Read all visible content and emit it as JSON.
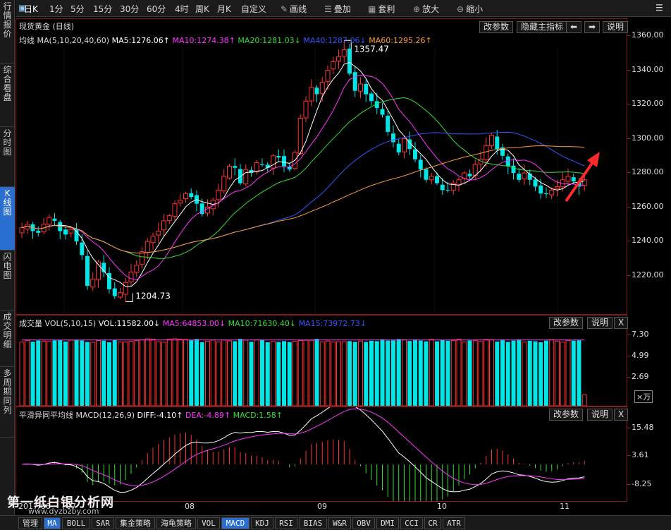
{
  "left_nav": [
    "行情报价",
    "综合看盘",
    "分时图",
    "K线图",
    "闪电图",
    "成交明细",
    "多周期同列"
  ],
  "left_nav_active": 3,
  "toolbar": {
    "periods": [
      "日K",
      "1分",
      "5分",
      "15分",
      "30分",
      "60分",
      "4时",
      "周K",
      "月K",
      "自定义"
    ],
    "selected_period": "日K",
    "tools": [
      {
        "icon": "pencil-icon",
        "glyph": "✎",
        "label": "画线"
      },
      {
        "icon": "stack-icon",
        "glyph": "☰",
        "label": "叠加"
      },
      {
        "icon": "arbitrage-icon",
        "glyph": "▦",
        "label": "套利"
      },
      {
        "icon": "zoom-in-icon",
        "glyph": "⊕",
        "label": "放大"
      },
      {
        "icon": "zoom-out-icon",
        "glyph": "⊖",
        "label": "缩小"
      }
    ],
    "menu_glyph": "☰"
  },
  "main_panel": {
    "instrument": "现货黄金 (日线)",
    "buttons": [
      "改参数",
      "隐藏主指标",
      "⬅",
      "➡",
      "说明"
    ],
    "ma_label": "均线 MA(5,10,20,40,60)",
    "ma_values": [
      {
        "text": "MA5:1276.06↑",
        "color": "#ffffff"
      },
      {
        "text": "MA10:1274.38↑",
        "color": "#ff33ff"
      },
      {
        "text": "MA20:1281.03↓",
        "color": "#33dd33"
      },
      {
        "text": "MA40:1287.06↓",
        "color": "#3355ff"
      },
      {
        "text": "MA60:1295.26↑",
        "color": "#ff9933"
      }
    ],
    "price_axis": [
      "1360.00",
      "1340.00",
      "1320.00",
      "1300.00",
      "1280.00",
      "1260.00",
      "1240.00",
      "1220.00"
    ],
    "high_label": "1357.47",
    "low_label": "1204.73"
  },
  "volume_panel": {
    "label": "成交量 VOL(5,10,15)",
    "values": [
      {
        "text": "VOL:11582.00↓",
        "color": "#ffffff"
      },
      {
        "text": "MA5:64853.00↓",
        "color": "#ff33ff"
      },
      {
        "text": "MA10:71630.40↓",
        "color": "#33dd33"
      },
      {
        "text": "MA15:73972.73↓",
        "color": "#3355ff"
      }
    ],
    "buttons": [
      "改参数",
      "说明",
      "X"
    ],
    "axis": [
      "7.30",
      "4.99",
      "2.69"
    ],
    "unit": "×万"
  },
  "macd_panel": {
    "label": "平滑异同平均线 MACD(12,26,9)",
    "values": [
      {
        "text": "DIFF:-4.10↑",
        "color": "#ffffff"
      },
      {
        "text": "DEA:-4.89↑",
        "color": "#ff33ff"
      },
      {
        "text": "MACD:1.58↑",
        "color": "#33dd33"
      }
    ],
    "buttons": [
      "改参数",
      "说明",
      "X"
    ],
    "axis": [
      "15.48",
      "3.61",
      "-8.25"
    ]
  },
  "x_axis": [
    "2017/06",
    "07",
    "08",
    "09",
    "10",
    "11"
  ],
  "bottom_tabs": [
    "管理",
    "MA",
    "BOLL",
    "SAR",
    "集金策略",
    "海龟策略",
    "VOL",
    "MACD",
    "KDJ",
    "RSI",
    "BIAS",
    "W&R",
    "OBV",
    "DMI",
    "CCI",
    "CR",
    "ATR"
  ],
  "bottom_selected": [
    "MA",
    "MACD"
  ],
  "watermark": "第一纸白银分析网",
  "watermark_url": "www.dyzbzby.com",
  "chart_data": {
    "type": "candlestick",
    "title": "现货黄金 (日线)",
    "y_range": [
      1200,
      1365
    ],
    "extremes": {
      "high": 1357.47,
      "low": 1204.73
    },
    "months": [
      "2017/06",
      "07",
      "08",
      "09",
      "10",
      "11"
    ],
    "closes": [
      1248,
      1250,
      1246,
      1245,
      1250,
      1254,
      1252,
      1246,
      1244,
      1247,
      1240,
      1232,
      1214,
      1218,
      1228,
      1222,
      1212,
      1208,
      1210,
      1216,
      1222,
      1226,
      1234,
      1240,
      1243,
      1246,
      1252,
      1255,
      1262,
      1264,
      1268,
      1266,
      1262,
      1256,
      1260,
      1264,
      1270,
      1278,
      1284,
      1283,
      1274,
      1282,
      1280,
      1286,
      1285,
      1283,
      1290,
      1289,
      1284,
      1282,
      1292,
      1312,
      1322,
      1330,
      1326,
      1333,
      1340,
      1345,
      1348,
      1352,
      1338,
      1328,
      1332,
      1326,
      1322,
      1318,
      1314,
      1304,
      1298,
      1292,
      1300,
      1294,
      1288,
      1282,
      1276,
      1278,
      1274,
      1270,
      1270,
      1274,
      1276,
      1280,
      1278,
      1285,
      1288,
      1296,
      1302,
      1294,
      1290,
      1284,
      1280,
      1276,
      1280,
      1276,
      1272,
      1268,
      1268,
      1270,
      1272,
      1276,
      1278,
      1275,
      1272,
      1276
    ],
    "volume_scale_max": 8.4,
    "macd_range": [
      -12,
      18
    ]
  }
}
